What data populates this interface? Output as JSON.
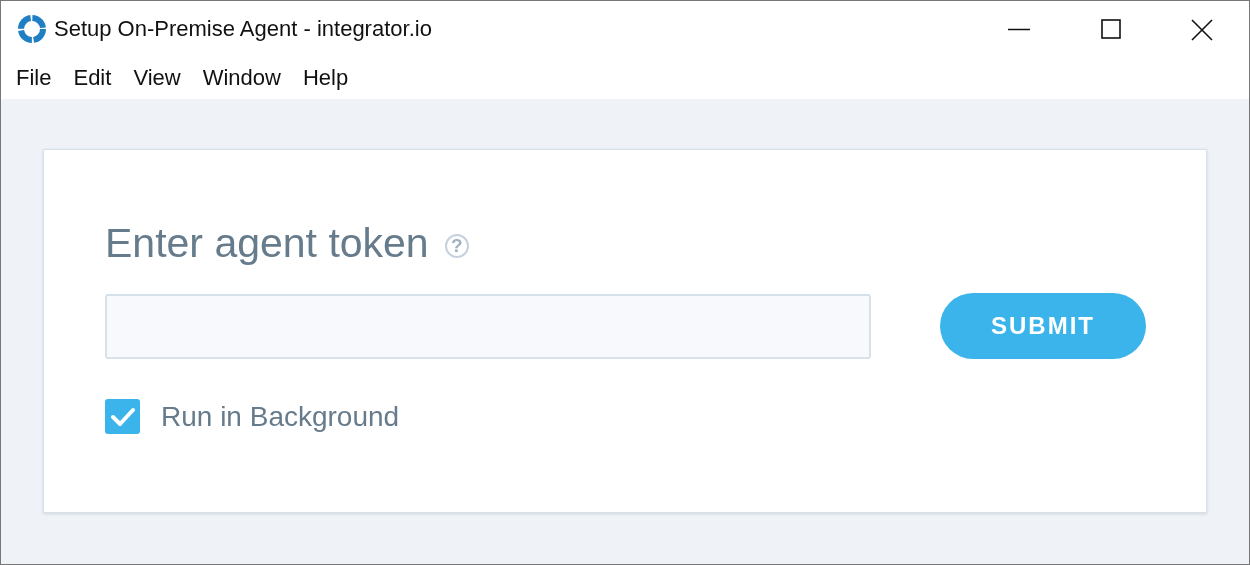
{
  "window": {
    "title": "Setup On-Premise Agent - integrator.io"
  },
  "menu": [
    "File",
    "Edit",
    "View",
    "Window",
    "Help"
  ],
  "form": {
    "heading": "Enter agent token",
    "help": "?",
    "submit": "SUBMIT",
    "run_in_background": {
      "label": "Run in Background",
      "checked": true
    }
  }
}
